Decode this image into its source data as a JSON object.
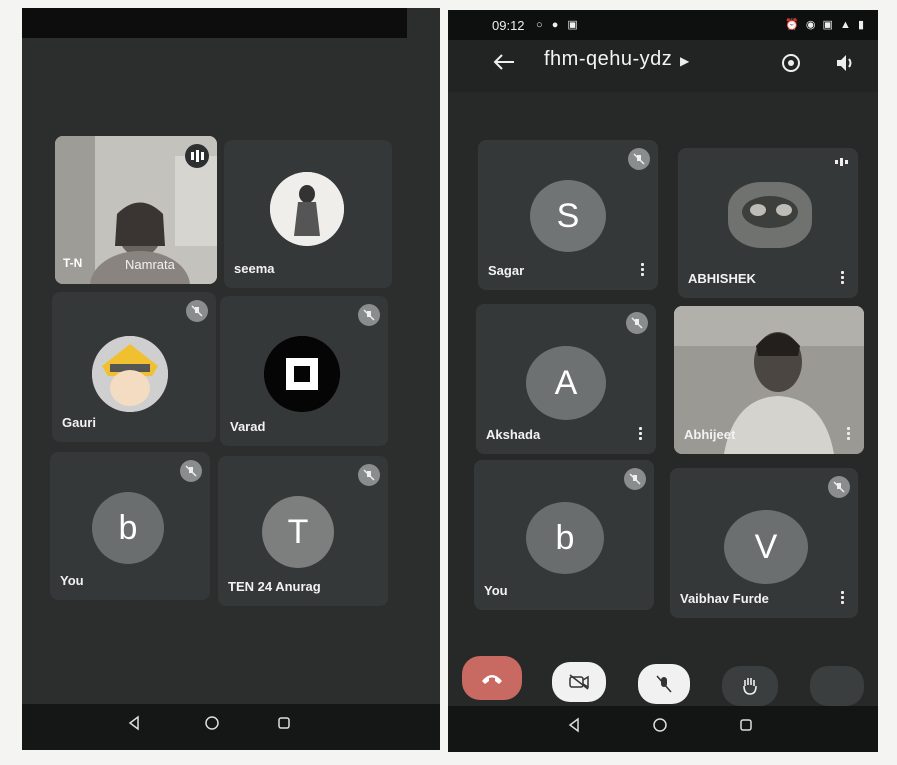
{
  "left": {
    "tiles": [
      {
        "name": "Namrata",
        "overlay": "T-N"
      },
      {
        "name": "seema"
      },
      {
        "name": "Gauri"
      },
      {
        "name": "Varad"
      },
      {
        "name": "You",
        "initial": "b"
      },
      {
        "name": "TEN 24 Anurag",
        "initial": "T"
      }
    ]
  },
  "right": {
    "time": "09:12",
    "meeting_code": "fhm-qehu-ydz",
    "tiles": [
      {
        "name": "Sagar",
        "initial": "S"
      },
      {
        "name": "ABHISHEK"
      },
      {
        "name": "Akshada",
        "initial": "A"
      },
      {
        "name": "Abhijeet"
      },
      {
        "name": "You",
        "initial": "b"
      },
      {
        "name": "Vaibhav Furde",
        "initial": "V"
      }
    ]
  },
  "colors": {
    "end_call": "#c96a62",
    "muted_button": "#f1f1f1",
    "dark_button": "#3b3e3e"
  },
  "icons": [
    "back-arrow-icon",
    "switch-camera-icon",
    "speaker-icon",
    "mic-off-icon",
    "end-call-icon",
    "camera-off-icon",
    "raise-hand-icon",
    "more-vert-icon",
    "nav-back-icon",
    "nav-home-icon",
    "nav-recents-icon"
  ]
}
